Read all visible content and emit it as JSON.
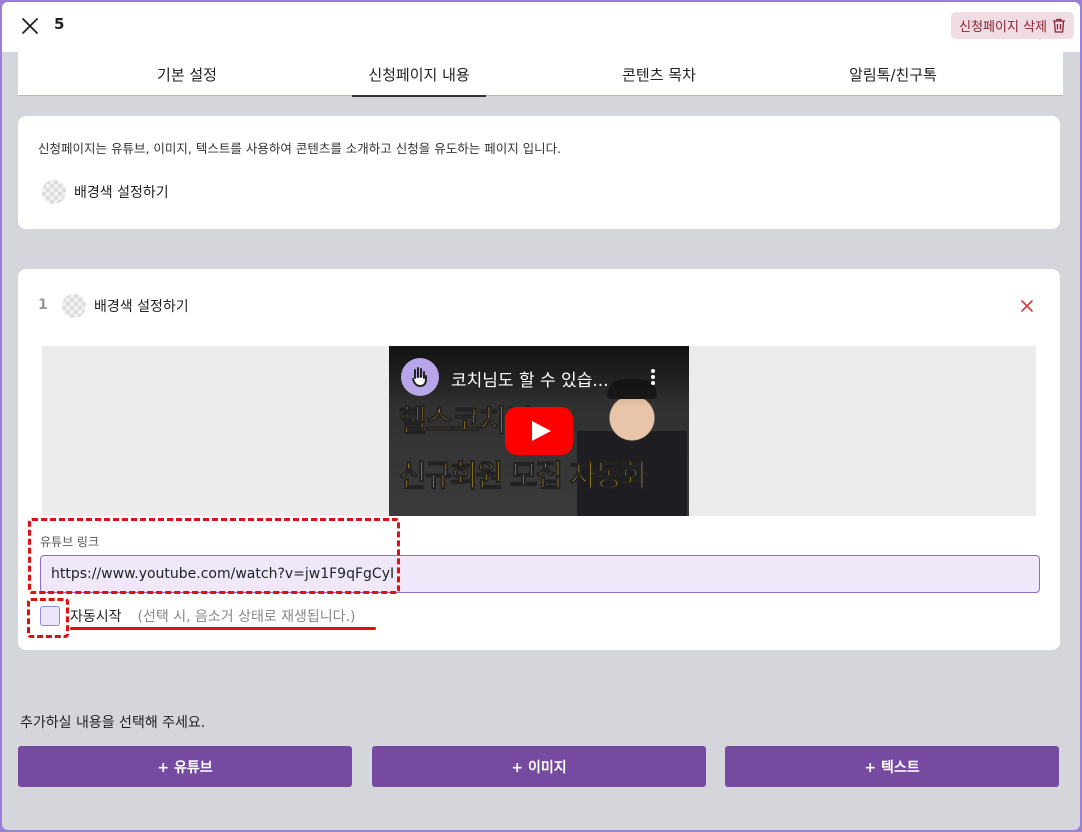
{
  "header": {
    "page_number": "5",
    "delete_label": "신청페이지 삭제"
  },
  "tabs": [
    {
      "label": "기본 설정"
    },
    {
      "label": "신청페이지 내용",
      "active": true
    },
    {
      "label": "콘텐츠 목차"
    },
    {
      "label": "알림톡/친구톡"
    }
  ],
  "intro": {
    "description": "신청페이지는 유튜브, 이미지, 텍스트를 사용하여 콘텐츠를 소개하고 신청을 유도하는 페이지 입니다.",
    "bg_label": "배경색 설정하기"
  },
  "block": {
    "index": "1",
    "bg_label": "배경색 설정하기",
    "video": {
      "title": "코치님도 할 수 있습...",
      "thumb_line1": "헬스코치님!",
      "thumb_line2": "신규회원 모집 자동화"
    },
    "link_label": "유튜브 링크",
    "link_value": "https://www.youtube.com/watch?v=jw1F9qFgCyI",
    "autoplay_label": "자동시작",
    "autoplay_hint": "(선택 시, 음소거 상태로 재생됩니다.)",
    "autoplay_checked": false
  },
  "add_section": {
    "prompt": "추가하실 내용을 선택해 주세요.",
    "buttons": [
      {
        "label": "+ 유튜브"
      },
      {
        "label": "+ 이미지"
      },
      {
        "label": "+ 텍스트"
      }
    ]
  },
  "colors": {
    "accent": "#764aa0",
    "annotation": "#e01010",
    "delete_bg": "#f0dde3"
  }
}
